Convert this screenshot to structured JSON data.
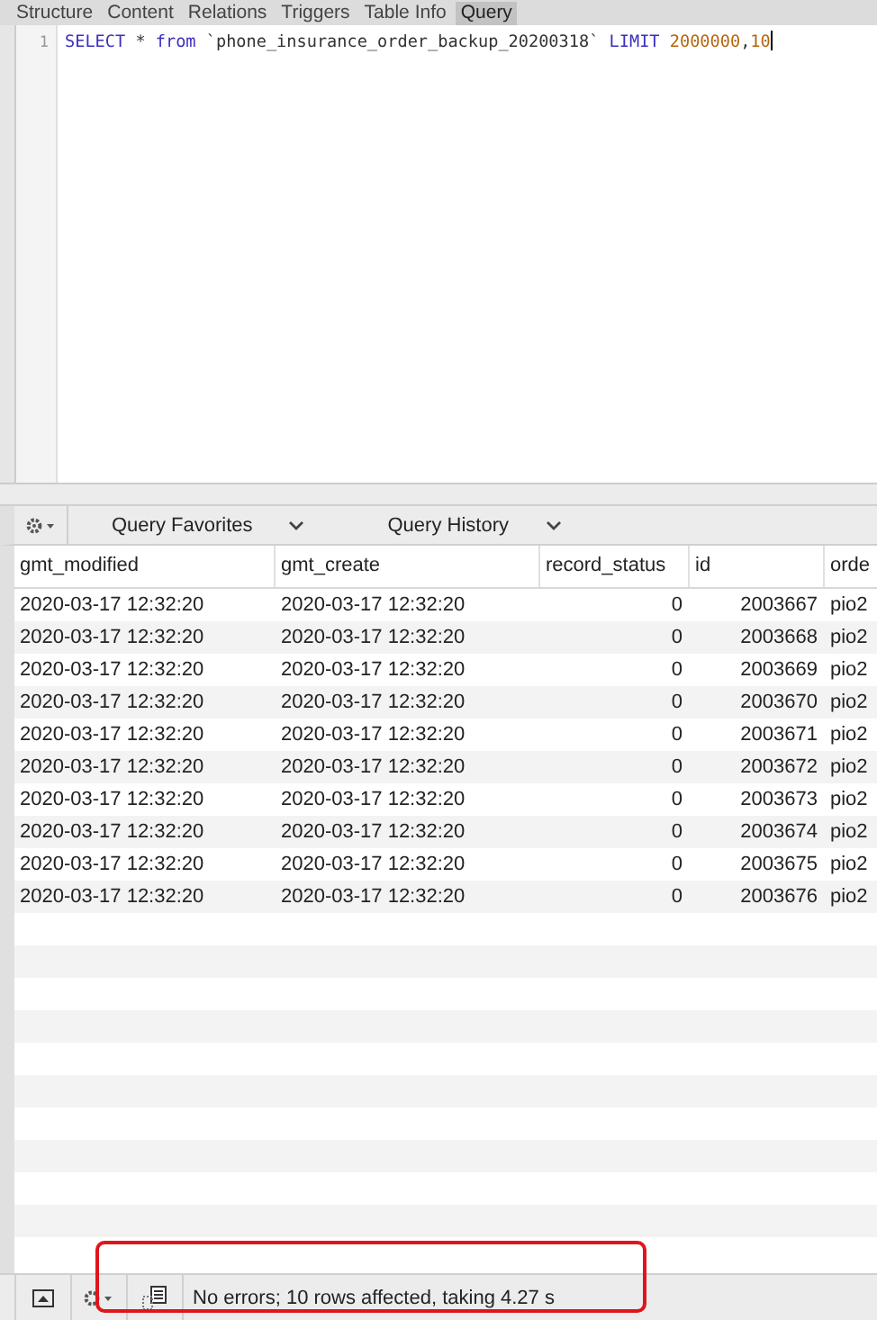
{
  "tabs": [
    {
      "label": "Structure",
      "selected": false
    },
    {
      "label": "Content",
      "selected": false
    },
    {
      "label": "Relations",
      "selected": false
    },
    {
      "label": "Triggers",
      "selected": false
    },
    {
      "label": "Table Info",
      "selected": false
    },
    {
      "label": "Query",
      "selected": true
    }
  ],
  "editor": {
    "lines": [
      {
        "number": "1",
        "tokens": [
          {
            "kind": "keyword",
            "text": "SELECT"
          },
          {
            "kind": "plain",
            "text": " * "
          },
          {
            "kind": "keyword",
            "text": "from"
          },
          {
            "kind": "plain",
            "text": " `phone_insurance_order_backup_20200318` "
          },
          {
            "kind": "keyword",
            "text": "LIMIT "
          },
          {
            "kind": "number",
            "text": "2000000"
          },
          {
            "kind": "plain",
            "text": ","
          },
          {
            "kind": "number",
            "text": "10"
          }
        ]
      }
    ]
  },
  "toolbar": {
    "favorites": "Query Favorites",
    "history": "Query History"
  },
  "table": {
    "columns": [
      "gmt_modified",
      "gmt_create",
      "record_status",
      "id",
      "orde"
    ],
    "rows": [
      [
        "2020-03-17 12:32:20",
        "2020-03-17 12:32:20",
        "0",
        "2003667",
        "pio2"
      ],
      [
        "2020-03-17 12:32:20",
        "2020-03-17 12:32:20",
        "0",
        "2003668",
        "pio2"
      ],
      [
        "2020-03-17 12:32:20",
        "2020-03-17 12:32:20",
        "0",
        "2003669",
        "pio2"
      ],
      [
        "2020-03-17 12:32:20",
        "2020-03-17 12:32:20",
        "0",
        "2003670",
        "pio2"
      ],
      [
        "2020-03-17 12:32:20",
        "2020-03-17 12:32:20",
        "0",
        "2003671",
        "pio2"
      ],
      [
        "2020-03-17 12:32:20",
        "2020-03-17 12:32:20",
        "0",
        "2003672",
        "pio2"
      ],
      [
        "2020-03-17 12:32:20",
        "2020-03-17 12:32:20",
        "0",
        "2003673",
        "pio2"
      ],
      [
        "2020-03-17 12:32:20",
        "2020-03-17 12:32:20",
        "0",
        "2003674",
        "pio2"
      ],
      [
        "2020-03-17 12:32:20",
        "2020-03-17 12:32:20",
        "0",
        "2003675",
        "pio2"
      ],
      [
        "2020-03-17 12:32:20",
        "2020-03-17 12:32:20",
        "0",
        "2003676",
        "pio2"
      ]
    ]
  },
  "status_bar": {
    "message": "No errors; 10 rows affected, taking 4.27 s"
  }
}
